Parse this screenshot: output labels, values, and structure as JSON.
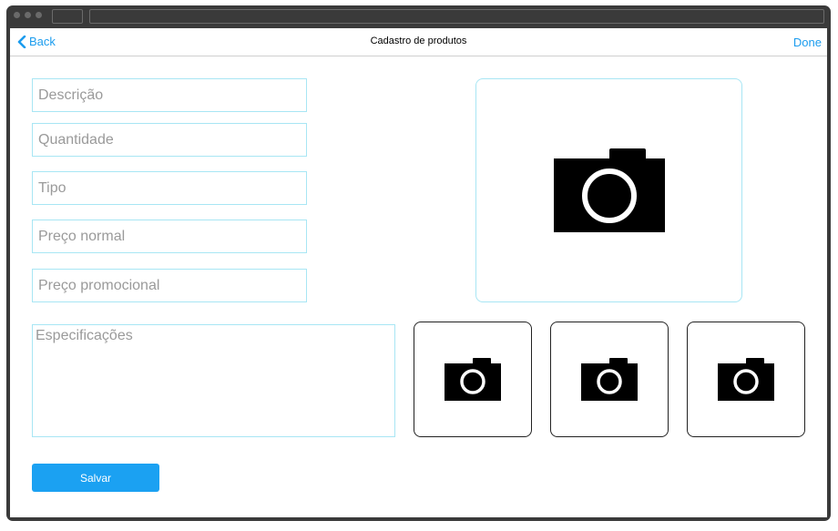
{
  "nav": {
    "back_label": "Back",
    "title": "Cadastro de produtos",
    "done_label": "Done"
  },
  "form": {
    "descricao_placeholder": "Descrição",
    "quantidade_placeholder": "Quantidade",
    "tipo_placeholder": "Tipo",
    "preco_normal_placeholder": "Preço normal",
    "preco_promocional_placeholder": "Preço promocional",
    "especificacoes_placeholder": "Especificações"
  },
  "photos": {
    "main_icon": "camera-icon",
    "thumbnail_icons": [
      "camera-icon",
      "camera-icon",
      "camera-icon"
    ]
  },
  "actions": {
    "save_label": "Salvar"
  },
  "colors": {
    "accent": "#1ba1f2",
    "field_border": "#a8e6f4",
    "frame": "#3a3a3a"
  }
}
